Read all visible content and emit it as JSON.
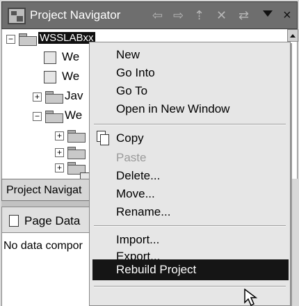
{
  "window": {
    "title": "Project Navigator",
    "toolbar_icons": [
      "back-arrow-icon",
      "forward-arrow-icon",
      "up-arrow-icon",
      "collapse-all-icon",
      "link-with-editor-icon",
      "view-menu-icon",
      "close-icon"
    ],
    "close_glyph": "×"
  },
  "tree": {
    "root": {
      "label": "WSSLABxx",
      "expander": "⊟"
    },
    "rows": [
      {
        "label": "We",
        "icon": "deployment-descriptor-icon"
      },
      {
        "label": "We",
        "icon": "web-content-icon"
      },
      {
        "label": "Jav",
        "icon": "java-resources-icon",
        "expander": "+"
      },
      {
        "label": "We",
        "icon": "web-folder-icon",
        "expander": "−"
      },
      {
        "label": "",
        "icon": "folder-icon",
        "expander": "+"
      },
      {
        "label": "",
        "icon": "folder-icon",
        "expander": "+"
      },
      {
        "label": "",
        "icon": "folder-icon",
        "expander": "+"
      },
      {
        "label": "",
        "icon": "file-icon"
      }
    ]
  },
  "lower": {
    "tab_label": "Project Navigat",
    "page_data_label": "Page Data",
    "page_data_text": "No data compor"
  },
  "context_menu": {
    "items": [
      {
        "label": "New",
        "enabled": true
      },
      {
        "label": "Go Into",
        "enabled": true
      },
      {
        "label": "Go To",
        "enabled": true
      },
      {
        "label": "Open in New Window",
        "enabled": true
      },
      {
        "label": "Copy",
        "enabled": true,
        "icon": "copy-icon"
      },
      {
        "label": "Paste",
        "enabled": false
      },
      {
        "label": "Delete...",
        "enabled": true
      },
      {
        "label": "Move...",
        "enabled": true
      },
      {
        "label": "Rename...",
        "enabled": true
      },
      {
        "label": "Import...",
        "enabled": true
      },
      {
        "label": "Export...",
        "enabled": true
      },
      {
        "label": "Rebuild Project",
        "enabled": true,
        "highlighted": true
      }
    ]
  }
}
